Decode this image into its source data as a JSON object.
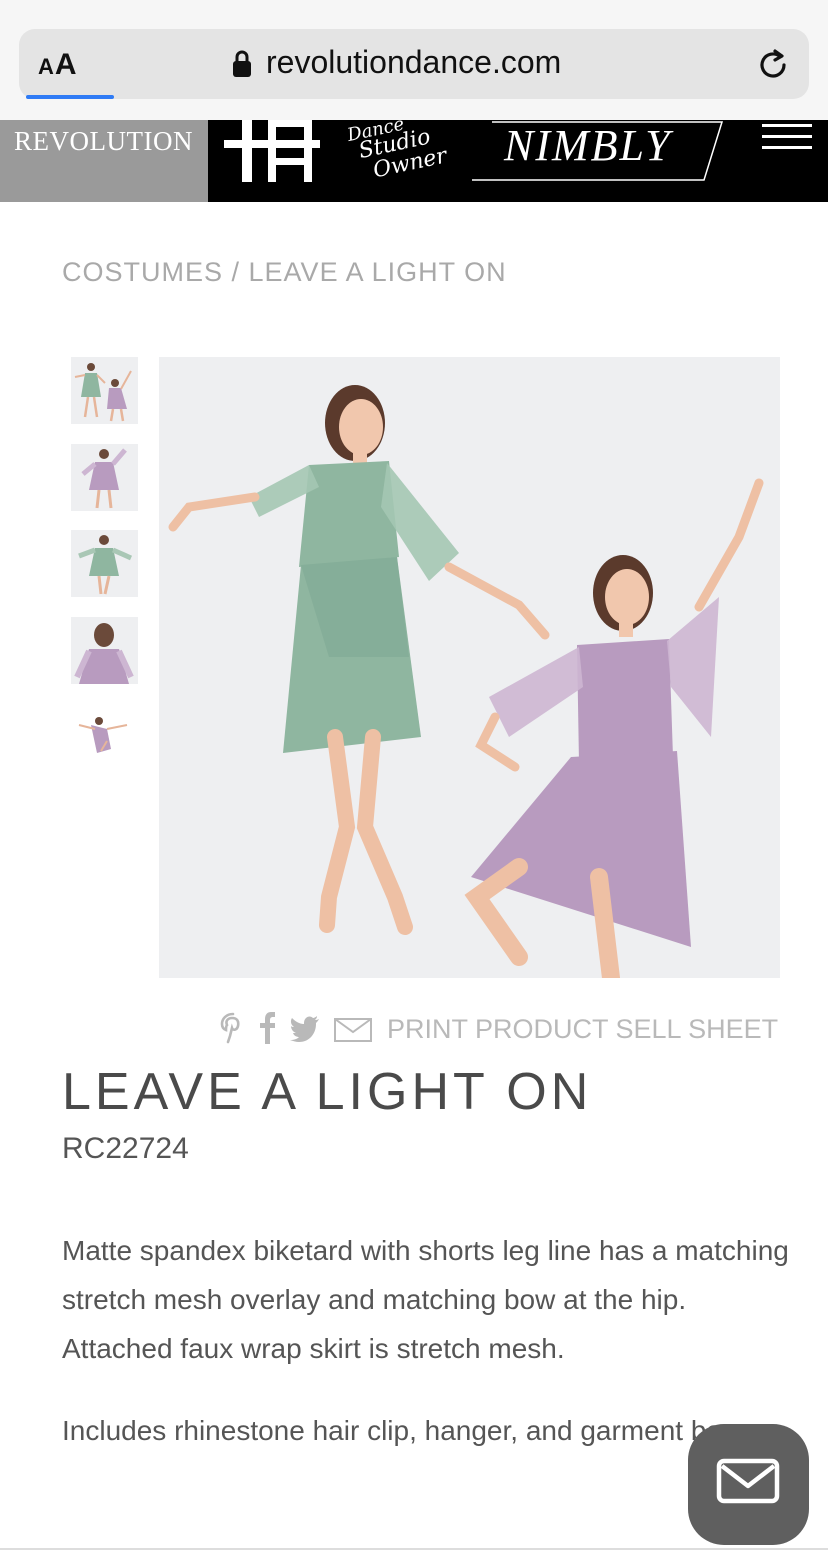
{
  "browser": {
    "text_size_label": "AA",
    "url": "revolutiondance.com"
  },
  "brand_nav": {
    "revolution": "REVOLUTION",
    "studio_owner_top": "Dance",
    "studio_owner_mid": "Studio",
    "studio_owner_bottom": "Owner",
    "nimbly": "NIMBLY"
  },
  "breadcrumb": {
    "category": "COSTUMES",
    "separator": " / ",
    "current": "LEAVE A LIGHT ON"
  },
  "gallery": {
    "thumbnail_count": 5,
    "colors": {
      "sage": "#8fb6a0",
      "lavender": "#b89bbf",
      "background": "#eeeff1"
    }
  },
  "share": {
    "icons": [
      "pinterest-icon",
      "facebook-icon",
      "twitter-icon",
      "email-icon"
    ],
    "print_label": "PRINT PRODUCT SELL SHEET"
  },
  "product": {
    "title": "LEAVE A LIGHT ON",
    "sku": "RC22724",
    "description_1": "Matte spandex biketard with shorts leg line has a matching stretch mesh overlay and matching bow at the hip. Attached faux wrap skirt is stretch mesh.",
    "description_2": "Includes rhinestone hair clip, hanger, and garment bag."
  }
}
